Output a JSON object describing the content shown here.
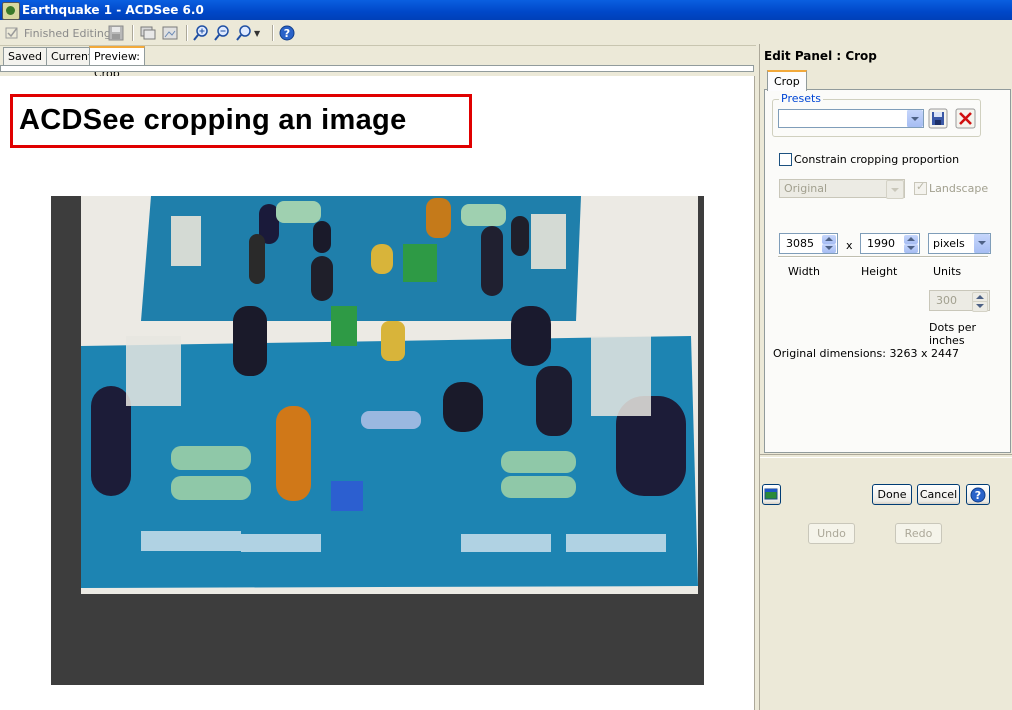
{
  "window": {
    "title": "Earthquake 1 - ACDSee 6.0"
  },
  "toolbar": {
    "finished_editing_label": "Finished Editing"
  },
  "tabs": [
    {
      "label": "Saved"
    },
    {
      "label": "Current"
    },
    {
      "label": "Preview: Crop"
    }
  ],
  "annotation": {
    "text": "ACDSee cropping an image"
  },
  "edit_panel": {
    "title": "Edit Panel : Crop",
    "tab_label": "Crop",
    "presets": {
      "label": "Presets",
      "value": ""
    },
    "constrain_label": "Constrain cropping proportion",
    "constrain_checked": false,
    "proportion": {
      "value": "Original"
    },
    "landscape": {
      "label": "Landscape",
      "checked": true
    },
    "width": {
      "value": "3085",
      "label": "Width"
    },
    "times_sign": "x",
    "height": {
      "value": "1990",
      "label": "Height"
    },
    "units": {
      "value": "pixels",
      "label": "Units"
    },
    "dpi": {
      "value": "300",
      "label": "Dots per inches"
    },
    "original_dimensions": "Original dimensions: 3263 x 2447"
  },
  "buttons": {
    "done": "Done",
    "cancel": "Cancel",
    "undo": "Undo",
    "redo": "Redo"
  },
  "colors": {
    "title_bar": "#0047c8",
    "annotation_border": "#e00000",
    "active_tab_accent": "#f2a93b"
  }
}
